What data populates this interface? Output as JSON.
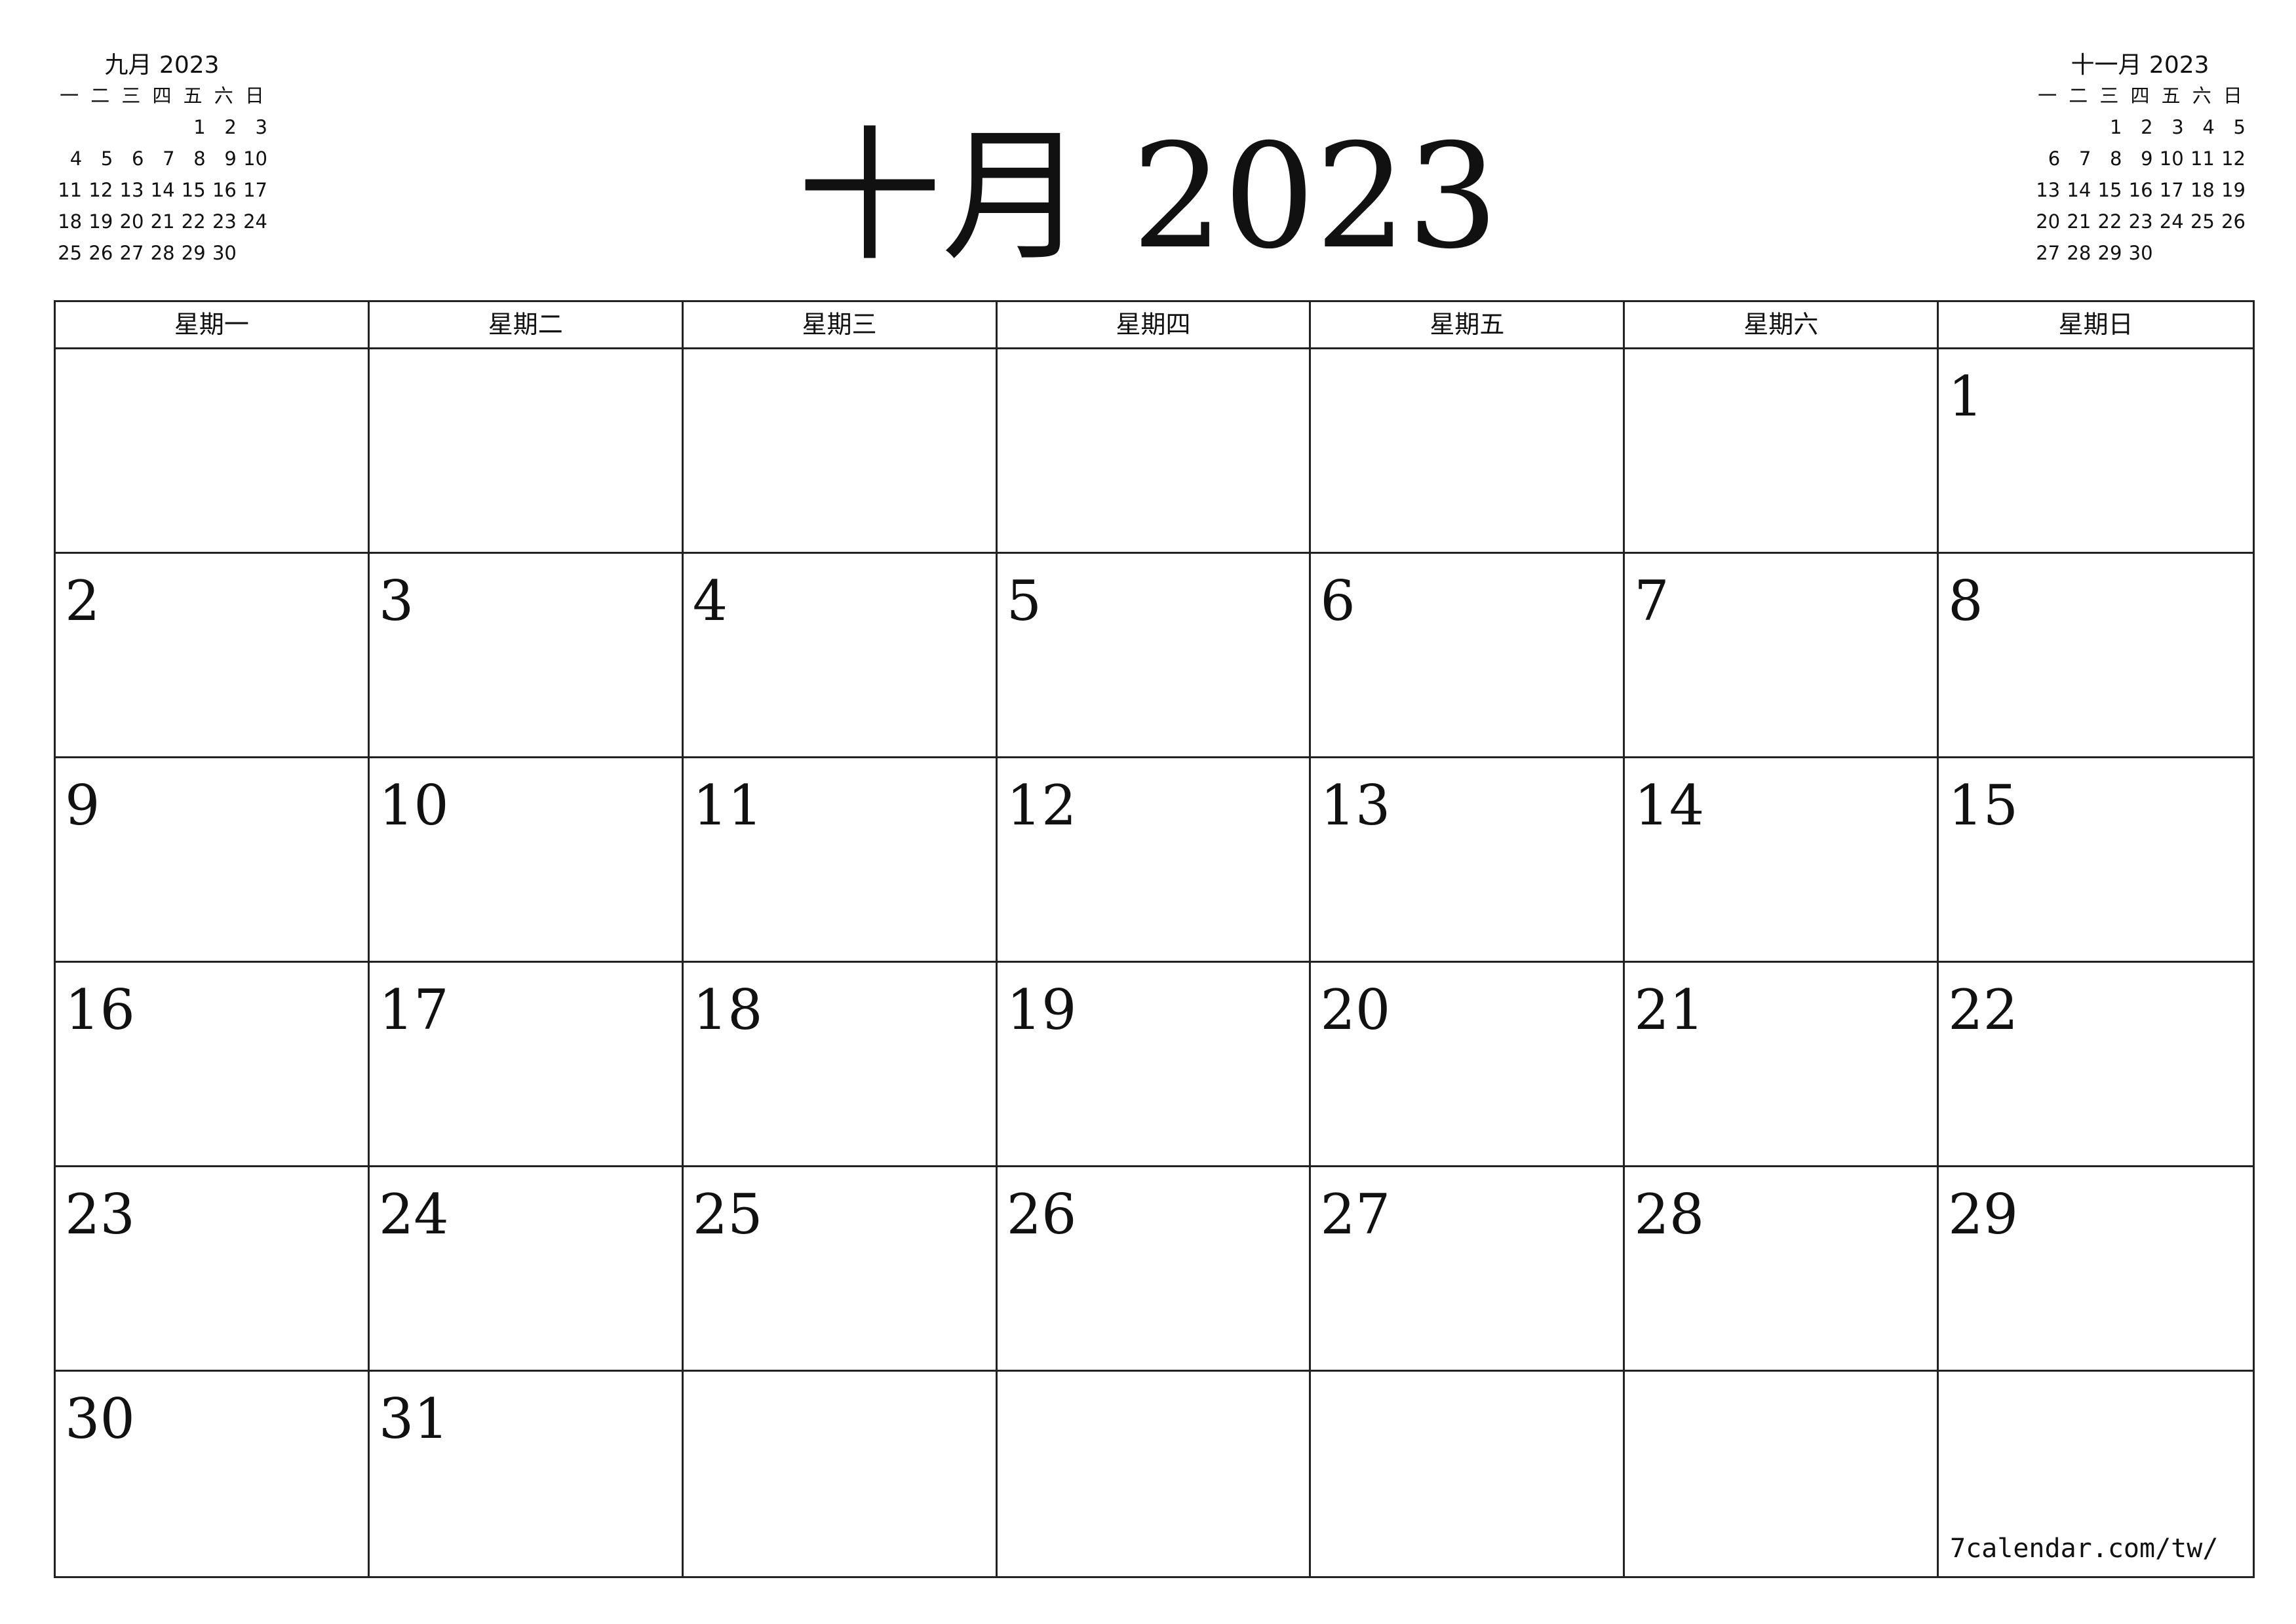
{
  "title": "十月 2023",
  "prev_month": {
    "title": "九月 2023",
    "weekdays": [
      "一",
      "二",
      "三",
      "四",
      "五",
      "六",
      "日"
    ],
    "weeks": [
      [
        "",
        "",
        "",
        "",
        "1",
        "2",
        "3"
      ],
      [
        "4",
        "5",
        "6",
        "7",
        "8",
        "9",
        "10"
      ],
      [
        "11",
        "12",
        "13",
        "14",
        "15",
        "16",
        "17"
      ],
      [
        "18",
        "19",
        "20",
        "21",
        "22",
        "23",
        "24"
      ],
      [
        "25",
        "26",
        "27",
        "28",
        "29",
        "30",
        ""
      ]
    ]
  },
  "next_month": {
    "title": "十一月 2023",
    "weekdays": [
      "一",
      "二",
      "三",
      "四",
      "五",
      "六",
      "日"
    ],
    "weeks": [
      [
        "",
        "",
        "1",
        "2",
        "3",
        "4",
        "5"
      ],
      [
        "6",
        "7",
        "8",
        "9",
        "10",
        "11",
        "12"
      ],
      [
        "13",
        "14",
        "15",
        "16",
        "17",
        "18",
        "19"
      ],
      [
        "20",
        "21",
        "22",
        "23",
        "24",
        "25",
        "26"
      ],
      [
        "27",
        "28",
        "29",
        "30",
        "",
        "",
        ""
      ]
    ]
  },
  "weekday_headers": [
    "星期一",
    "星期二",
    "星期三",
    "星期四",
    "星期五",
    "星期六",
    "星期日"
  ],
  "days": [
    "",
    "",
    "",
    "",
    "",
    "",
    "1",
    "2",
    "3",
    "4",
    "5",
    "6",
    "7",
    "8",
    "9",
    "10",
    "11",
    "12",
    "13",
    "14",
    "15",
    "16",
    "17",
    "18",
    "19",
    "20",
    "21",
    "22",
    "23",
    "24",
    "25",
    "26",
    "27",
    "28",
    "29",
    "30",
    "31",
    "",
    "",
    "",
    "",
    ""
  ],
  "footer": "7calendar.com/tw/"
}
